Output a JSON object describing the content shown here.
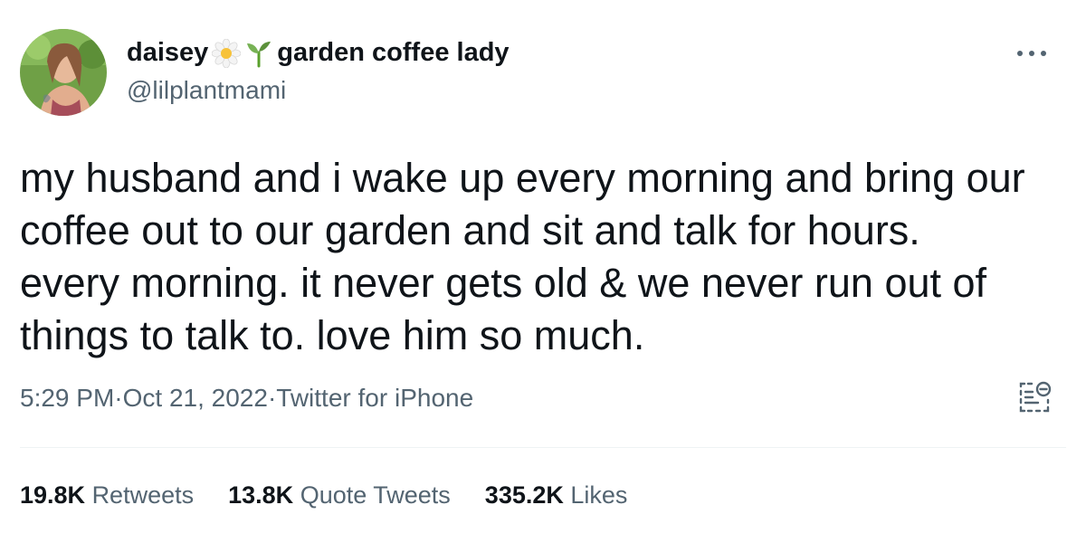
{
  "author": {
    "display_name": "daisey",
    "display_name_suffix": "garden coffee lady",
    "emoji_1": "daisy-flower-emoji",
    "emoji_2": "seedling-emoji",
    "handle": "@lilplantmami"
  },
  "tweet": {
    "lines": [
      "my husband and i wake up every morning and bring our",
      "coffee out to our garden and sit and talk for hours.",
      "every morning. it never gets old & we never run out of",
      "things to talk to. love him so much."
    ]
  },
  "meta": {
    "time": "5:29 PM",
    "separator": " · ",
    "date": "Oct 21, 2022",
    "source": "Twitter for iPhone"
  },
  "stats": {
    "retweets_count": "19.8K",
    "retweets_label": "Retweets",
    "quotes_count": "13.8K",
    "quotes_label": "Quote Tweets",
    "likes_count": "335.2K",
    "likes_label": "Likes"
  },
  "icons": {
    "more": "more-horizontal-icon",
    "analytics": "tweet-analytics-icon"
  },
  "colors": {
    "text_primary": "#0f1419",
    "text_secondary": "#536471",
    "divider": "#eff3f4"
  }
}
